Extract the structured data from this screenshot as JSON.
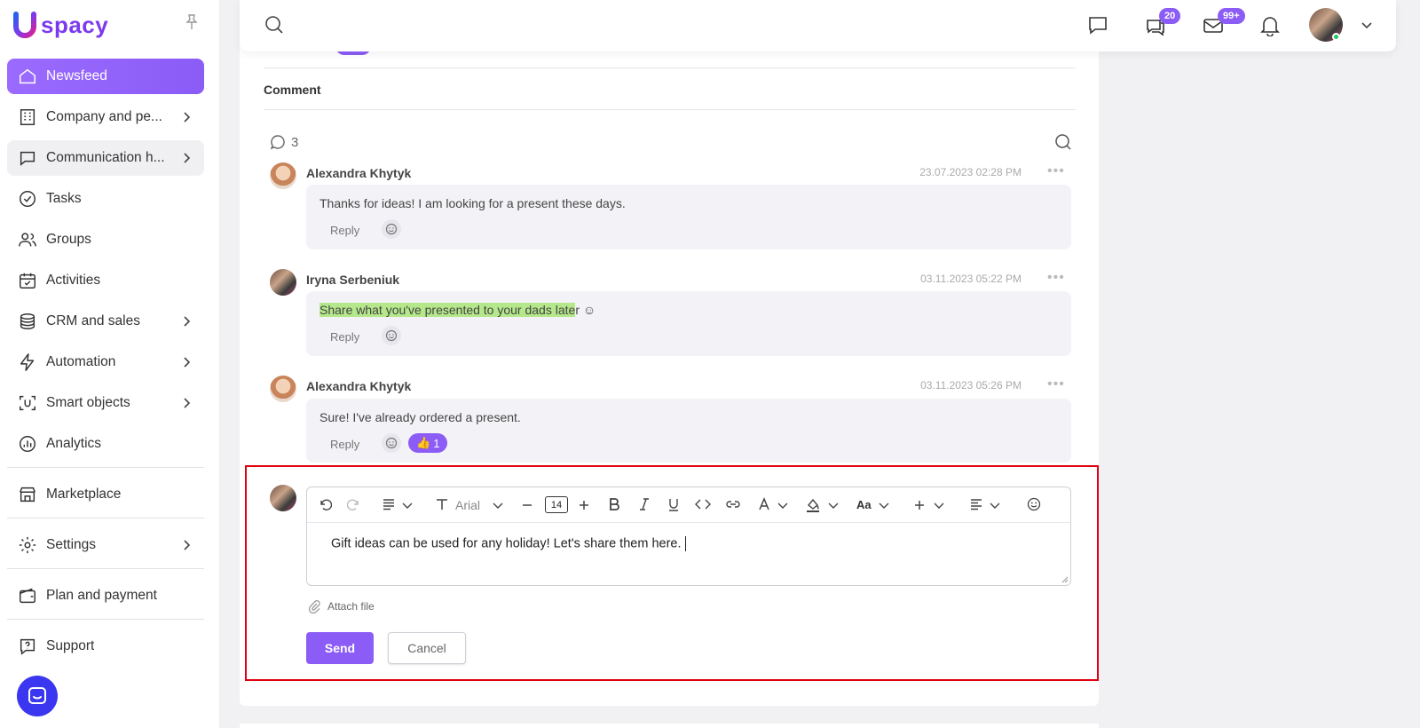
{
  "app": {
    "logo_text": "spacy",
    "logo_mark": "U"
  },
  "sidebar": {
    "items": [
      {
        "label": "Newsfeed",
        "icon": "home-icon"
      },
      {
        "label": "Company and pe...",
        "icon": "building-icon"
      },
      {
        "label": "Communication h...",
        "icon": "chat-icon"
      },
      {
        "label": "Tasks",
        "icon": "check-circle-icon"
      },
      {
        "label": "Groups",
        "icon": "users-icon"
      },
      {
        "label": "Activities",
        "icon": "calendar-icon"
      },
      {
        "label": "CRM and sales",
        "icon": "coins-icon"
      },
      {
        "label": "Automation",
        "icon": "bolt-icon"
      },
      {
        "label": "Smart objects",
        "icon": "smart-icon"
      },
      {
        "label": "Analytics",
        "icon": "chart-icon"
      },
      {
        "label": "Marketplace",
        "icon": "store-icon"
      },
      {
        "label": "Settings",
        "icon": "gear-icon"
      },
      {
        "label": "Plan and payment",
        "icon": "wallet-icon"
      },
      {
        "label": "Support",
        "icon": "help-icon"
      }
    ]
  },
  "topbar": {
    "chat_badge": "20",
    "mail_badge": "99+"
  },
  "comments": {
    "section_title": "Comment",
    "count": "3",
    "reply_label": "Reply",
    "items": [
      {
        "author": "Alexandra Khytyk",
        "date": "23.07.2023 02:28 PM",
        "text": "Thanks for ideas! I am looking for a present these days."
      },
      {
        "author": "Iryna Serbeniuk",
        "date": "03.11.2023 05:22 PM",
        "text_highlight": "Share what you've presented to your dads late",
        "text_rest": "r ☺"
      },
      {
        "author": "Alexandra Khytyk",
        "date": "03.11.2023 05:26 PM",
        "text": "Sure! I've already ordered a present.",
        "reaction_emoji": "👍",
        "reaction_count": "1"
      }
    ]
  },
  "editor": {
    "font": "Arial",
    "font_size": "14",
    "case_label": "Aa",
    "text": "Gift ideas can be used for any holiday! Let's share them here.",
    "attach_label": "Attach file",
    "send_label": "Send",
    "cancel_label": "Cancel"
  },
  "colors": {
    "accent": "#8b5cf6",
    "highlight": "#b5e88a",
    "annotation": "#e00010",
    "chat_button": "#3b36f0"
  }
}
